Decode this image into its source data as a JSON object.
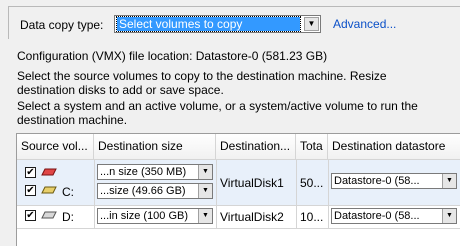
{
  "header": {
    "copy_type_label": "Data copy type:",
    "copy_type_value": "Select volumes to copy",
    "advanced_link": "Advanced..."
  },
  "info": {
    "config_location": "Configuration (VMX) file location: Datastore-0 (581.23 GB)",
    "line1": "Select the source volumes to copy to the destination machine. Resize",
    "line2": "destination disks to add or save space.",
    "line3": "Select a system and an active volume, or a system/active volume to run the",
    "line4": "destination machine."
  },
  "table": {
    "columns": [
      "Source vol...",
      "Destination size",
      "Destination...",
      "Tota",
      "Destination datastore"
    ],
    "rows": [
      {
        "checked": true,
        "icon": "red-drive-icon",
        "source": "",
        "dest_size": "...n size (350 MB)",
        "dest_disk": "VirtualDisk1",
        "total": "50...",
        "datastore": "Datastore-0 (58..."
      },
      {
        "checked": true,
        "icon": "yellow-drive-icon",
        "source": "C:",
        "dest_size": "...size (49.66 GB)",
        "dest_disk": "",
        "total": "",
        "datastore": ""
      },
      {
        "checked": true,
        "icon": "gray-drive-icon",
        "source": "D:",
        "dest_size": "...in size (100 GB)",
        "dest_disk": "VirtualDisk2",
        "total": "10...",
        "datastore": "Datastore-0 (58..."
      }
    ]
  },
  "colors": {
    "selection": "#3399ff",
    "link": "#0b50c8",
    "row_highlight": "#e8f0fa"
  }
}
